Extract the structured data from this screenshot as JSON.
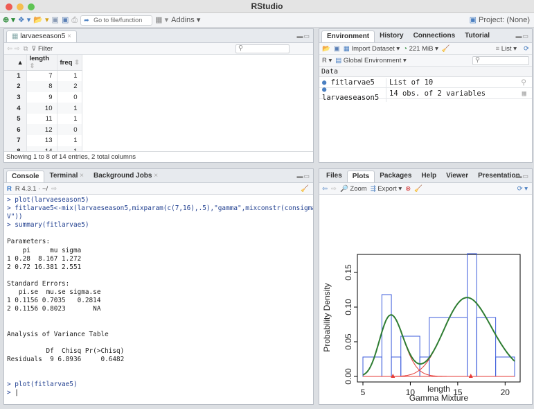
{
  "window": {
    "title": "RStudio"
  },
  "toolbar": {
    "goto_placeholder": "Go to file/function",
    "addins": "Addins",
    "project": "Project: (None)"
  },
  "source": {
    "tab": "larvaeseason5",
    "filter": "Filter",
    "columns": [
      "length",
      "freq"
    ],
    "rows": [
      {
        "n": "1",
        "length": "7",
        "freq": "1"
      },
      {
        "n": "2",
        "length": "8",
        "freq": "2"
      },
      {
        "n": "3",
        "length": "9",
        "freq": "0"
      },
      {
        "n": "4",
        "length": "10",
        "freq": "1"
      },
      {
        "n": "5",
        "length": "11",
        "freq": "1"
      },
      {
        "n": "6",
        "length": "12",
        "freq": "0"
      },
      {
        "n": "7",
        "length": "13",
        "freq": "1"
      },
      {
        "n": "8",
        "length": "14",
        "freq": "1"
      }
    ],
    "status": "Showing 1 to 8 of 14 entries, 2 total columns"
  },
  "console": {
    "tabs": [
      "Console",
      "Terminal",
      "Background Jobs"
    ],
    "version": "R 4.3.1 · ~/",
    "lines": [
      {
        "t": "> plot(larvaeseason5)",
        "c": "cmd"
      },
      {
        "t": "> fitlarvae5<-mix(larvaeseason5,mixparam(c(7,16),.5),\"gamma\",mixconstr(consigma = \"CC",
        "c": "cmd"
      },
      {
        "t": "V\"))",
        "c": "cmd"
      },
      {
        "t": "> summary(fitlarvae5)",
        "c": "cmd"
      },
      {
        "t": "",
        "c": "out"
      },
      {
        "t": "Parameters:",
        "c": "out"
      },
      {
        "t": "    pi     mu sigma",
        "c": "out"
      },
      {
        "t": "1 0.28  8.167 1.272",
        "c": "out"
      },
      {
        "t": "2 0.72 16.381 2.551",
        "c": "out"
      },
      {
        "t": "",
        "c": "out"
      },
      {
        "t": "Standard Errors:",
        "c": "out"
      },
      {
        "t": "   pi.se  mu.se sigma.se",
        "c": "out"
      },
      {
        "t": "1 0.1156 0.7035   0.2814",
        "c": "out"
      },
      {
        "t": "2 0.1156 0.8023       NA",
        "c": "out"
      },
      {
        "t": "",
        "c": "out"
      },
      {
        "t": "",
        "c": "out"
      },
      {
        "t": "Analysis of Variance Table",
        "c": "out"
      },
      {
        "t": "",
        "c": "out"
      },
      {
        "t": "          Df  Chisq Pr(>Chisq)",
        "c": "out"
      },
      {
        "t": "Residuals  9 6.8936     0.6482",
        "c": "out"
      },
      {
        "t": "",
        "c": "out"
      },
      {
        "t": "",
        "c": "out"
      },
      {
        "t": "> plot(fitlarvae5)",
        "c": "cmd"
      },
      {
        "t": "> ",
        "c": "cmd"
      }
    ]
  },
  "environment": {
    "tabs": [
      "Environment",
      "History",
      "Connections",
      "Tutorial"
    ],
    "import": "Import Dataset",
    "memory": "221 MiB",
    "list": "List",
    "lang": "R",
    "scope": "Global Environment",
    "section": "Data",
    "items": [
      {
        "name": "fitlarvae5",
        "value": "List of  10"
      },
      {
        "name": "larvaeseason5",
        "value": "14 obs. of 2 variables"
      }
    ]
  },
  "files": {
    "tabs": [
      "Files",
      "Plots",
      "Packages",
      "Help",
      "Viewer",
      "Presentation"
    ],
    "zoom": "Zoom",
    "export": "Export"
  },
  "chart_data": {
    "type": "line",
    "title": "",
    "xlabel": "length",
    "subtitle": "Gamma Mixture",
    "ylabel": "Probability Density",
    "xlim": [
      5,
      21
    ],
    "ylim": [
      0,
      0.17
    ],
    "xticks": [
      "5",
      "10",
      "15",
      "20"
    ],
    "yticks": [
      "0.00",
      "0.05",
      "0.10",
      "0.15"
    ],
    "histogram": [
      {
        "x0": 5,
        "x1": 7,
        "d": 0.028
      },
      {
        "x0": 7,
        "x1": 8,
        "d": 0.118
      },
      {
        "x0": 8,
        "x1": 9,
        "d": 0.028
      },
      {
        "x0": 9,
        "x1": 11,
        "d": 0.058
      },
      {
        "x0": 11,
        "x1": 12,
        "d": 0.028
      },
      {
        "x0": 12,
        "x1": 16,
        "d": 0.085
      },
      {
        "x0": 16,
        "x1": 17,
        "d": 0.177
      },
      {
        "x0": 17,
        "x1": 19,
        "d": 0.085
      },
      {
        "x0": 19,
        "x1": 21,
        "d": 0.028
      }
    ],
    "components": [
      {
        "pi": 0.28,
        "mu": 8.167,
        "sigma": 1.272
      },
      {
        "pi": 0.72,
        "mu": 16.381,
        "sigma": 2.551
      }
    ],
    "colors": {
      "histogram": "#3b5bdb",
      "mixture": "#2e7d32",
      "components": "#e53935"
    }
  }
}
